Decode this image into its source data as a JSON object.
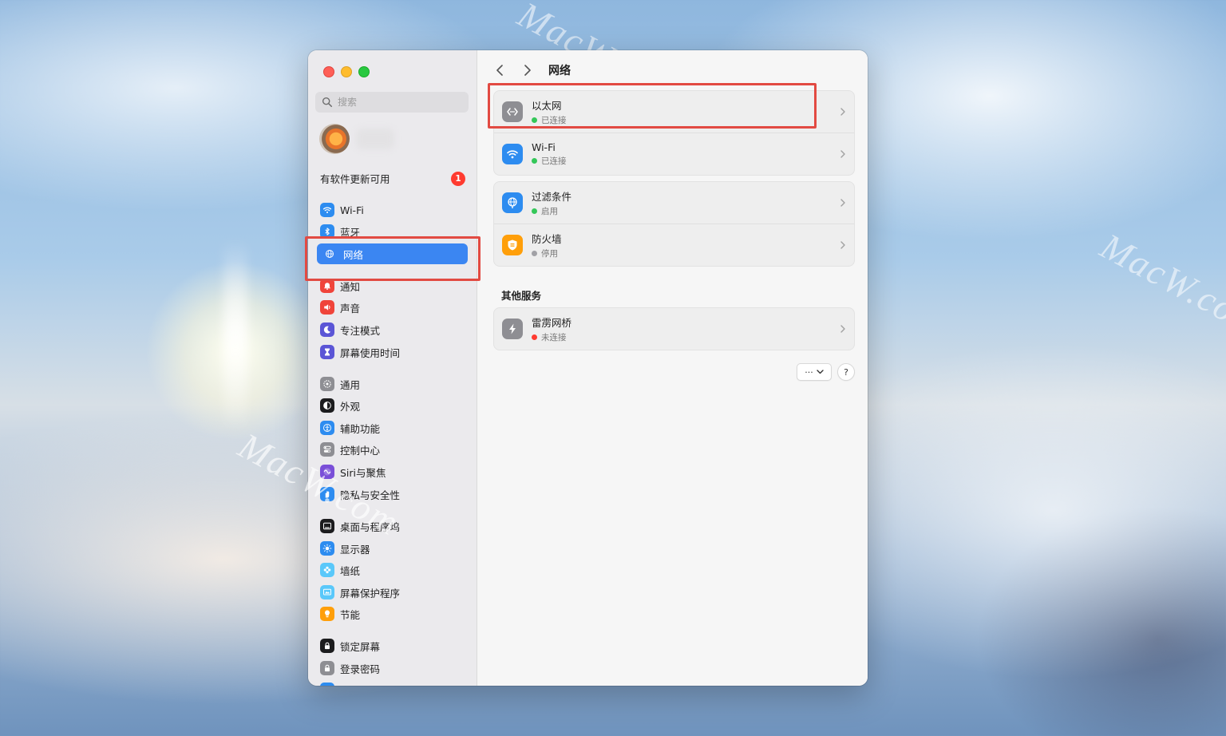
{
  "watermark": "MacW.com",
  "window": {
    "toolbar": {
      "title": "网络"
    },
    "sidebar": {
      "search_placeholder": "搜索",
      "update_label": "有软件更新可用",
      "update_count": "1",
      "items": [
        {
          "label": "Wi-Fi",
          "icon": "wifi-icon",
          "color": "#2d8cf0"
        },
        {
          "label": "蓝牙",
          "icon": "bluetooth-icon",
          "color": "#2d8cf0"
        },
        {
          "label": "网络",
          "icon": "globe-icon",
          "color": "#2d8cf0",
          "selected": true
        },
        {
          "label": "通知",
          "icon": "bell-icon",
          "color": "#f0443a"
        },
        {
          "label": "声音",
          "icon": "speaker-icon",
          "color": "#f0443a"
        },
        {
          "label": "专注模式",
          "icon": "moon-icon",
          "color": "#5b55d6"
        },
        {
          "label": "屏幕使用时间",
          "icon": "hourglass-icon",
          "color": "#5b55d6"
        },
        {
          "label": "通用",
          "icon": "gear-icon",
          "color": "#8e8e93"
        },
        {
          "label": "外观",
          "icon": "appearance-icon",
          "color": "#1c1c1e"
        },
        {
          "label": "辅助功能",
          "icon": "accessibility-icon",
          "color": "#2d8cf0"
        },
        {
          "label": "控制中心",
          "icon": "toggles-icon",
          "color": "#8e8e93"
        },
        {
          "label": "Siri与聚焦",
          "icon": "siri-icon",
          "color": "#7a4fd8"
        },
        {
          "label": "隐私与安全性",
          "icon": "hand-icon",
          "color": "#2d8cf0"
        },
        {
          "label": "桌面与程序坞",
          "icon": "dock-icon",
          "color": "#1c1c1e"
        },
        {
          "label": "显示器",
          "icon": "sun-icon",
          "color": "#2d8cf0"
        },
        {
          "label": "墙纸",
          "icon": "flower-icon",
          "color": "#5ac8fa"
        },
        {
          "label": "屏幕保护程序",
          "icon": "screensaver-icon",
          "color": "#5ac8fa"
        },
        {
          "label": "节能",
          "icon": "bulb-icon",
          "color": "#ff9f0a"
        },
        {
          "label": "锁定屏幕",
          "icon": "lock-screen-icon",
          "color": "#1c1c1e"
        },
        {
          "label": "登录密码",
          "icon": "lock-icon",
          "color": "#8e8e93"
        },
        {
          "label": "",
          "icon": "partial-icon",
          "color": "#2d8cf0"
        }
      ]
    },
    "main": {
      "services": [
        {
          "name": "以太网",
          "status": "已连接",
          "status_color": "#34c759",
          "icon": "ethernet-icon",
          "icon_color": "#8e8e93"
        },
        {
          "name": "Wi-Fi",
          "status": "已连接",
          "status_color": "#34c759",
          "icon": "wifi-icon",
          "icon_color": "#2d8cf0"
        }
      ],
      "filters": [
        {
          "name": "过滤条件",
          "status": "启用",
          "status_color": "#34c759",
          "icon": "globe-filter-icon",
          "icon_color": "#2d8cf0"
        },
        {
          "name": "防火墙",
          "status": "停用",
          "status_color": "#a1a1a6",
          "icon": "firewall-icon",
          "icon_color": "#ff9f0a"
        }
      ],
      "other_services_header": "其他服务",
      "other_services": [
        {
          "name": "雷雳网桥",
          "status": "未连接",
          "status_color": "#ff3b30",
          "icon": "thunderbolt-icon",
          "icon_color": "#8e8e93"
        }
      ],
      "more_button": "···",
      "help_button": "?"
    }
  }
}
